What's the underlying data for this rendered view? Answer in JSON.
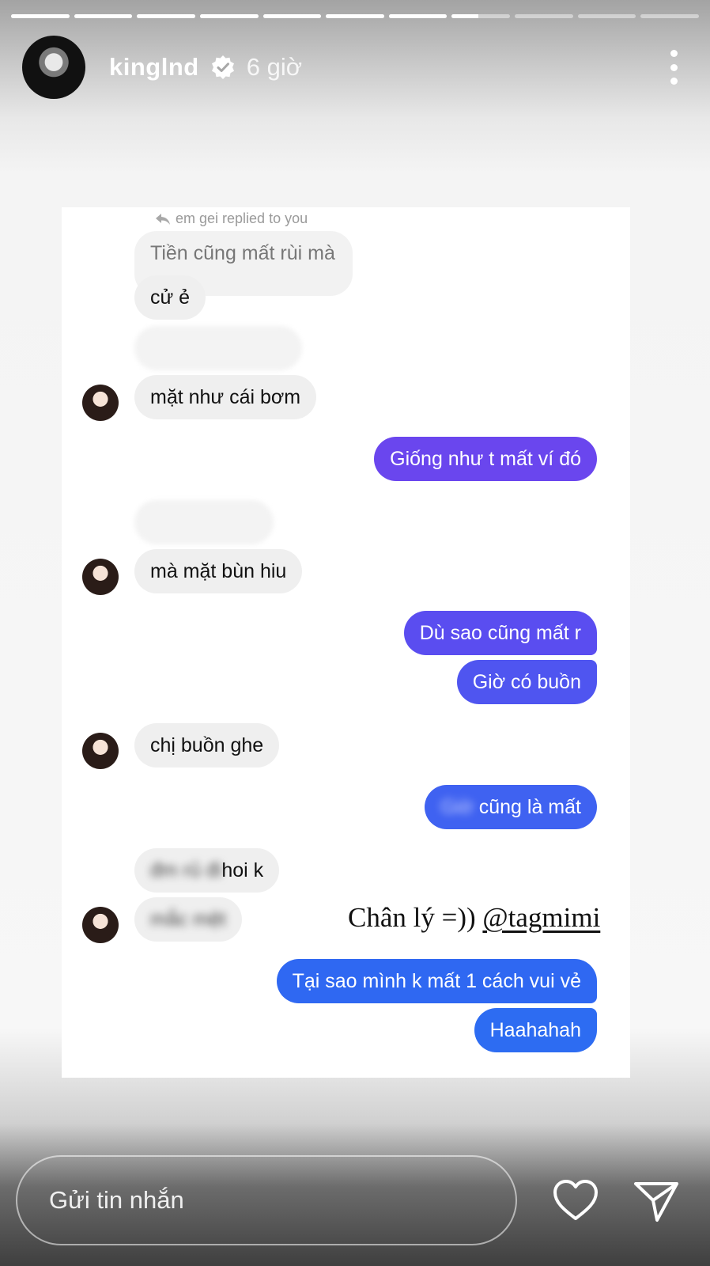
{
  "story": {
    "username": "kinglnd",
    "time": "6 giờ",
    "progress": [
      1,
      1,
      1,
      1,
      1,
      1,
      1,
      0.45,
      0,
      0,
      0
    ]
  },
  "screenshot": {
    "replied_label": "em gei replied to you",
    "messages": {
      "m1": "Tiền cũng mất rùi mà",
      "m2": "cử ẻ",
      "m3": "mặt như cái bơm",
      "m4": "Giống như t mất ví đó",
      "m5": "mà mặt bùn hiu",
      "m6": "Dù sao cũng mất r",
      "m7": "Giờ có buồn",
      "m8": "chị buồn ghe",
      "m9_hidden": "Giờ",
      "m9": "cũng là mất",
      "m10_hidden": "đm rủ đi",
      "m10": "hoi k",
      "m11_hidden": "mắc mệt",
      "m12": "Tại sao mình k mất 1 cách vui vẻ",
      "m13": "Haahahah"
    },
    "caption": "Chân lý =))",
    "mention": "@tagmimi"
  },
  "reply_bar": {
    "placeholder": "Gửi tin nhắn"
  },
  "colors": {
    "bubble_in": "#efefef",
    "bubble_out_purple": "#6a46ee",
    "bubble_out_blue": "#2d6cf2"
  },
  "icons": [
    "verified-badge-icon",
    "more-options-icon",
    "reply-arrow-icon",
    "heart-icon",
    "send-icon"
  ]
}
